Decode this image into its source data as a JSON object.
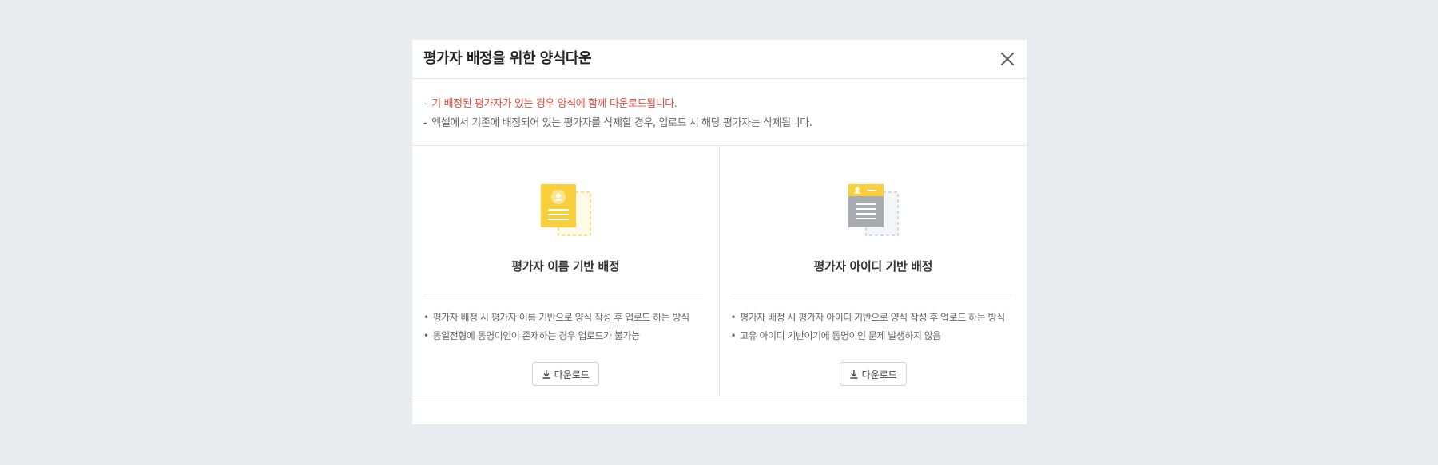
{
  "modal": {
    "title": "평가자 배정을 위한 양식다운",
    "close_icon": "close-icon"
  },
  "notice": {
    "lines": [
      {
        "dash": "-",
        "text": "기 배정된 평가자가 있는 경우 양식에 함께 다운로드됩니다.",
        "style": "warning",
        "color": "#e8493b"
      },
      {
        "dash": "-",
        "text": "엑셀에서 기존에 배정되어 있는 평가자를 삭제할 경우, 업로드 시 해당 평가자는 삭제됩니다.",
        "style": "normal"
      }
    ]
  },
  "options": [
    {
      "icon": "name-document-icon",
      "title": "평가자 이름 기반 배정",
      "bullets": [
        "평가자 배정 시 평가자 이름 기반으로 양식 작성 후 업로드 하는 방식",
        "동일전형에 동명이인이 존재하는 경우 업로드가 불가능"
      ],
      "download_label": "다운로드"
    },
    {
      "icon": "id-document-icon",
      "title": "평가자 아이디 기반 배정",
      "bullets": [
        "평가자 배정 시 평가자 아이디 기반으로 양식 작성 후 업로드 하는 방식",
        "고유 아이디 기반이기에 동명이인 문제 발생하지 않음"
      ],
      "download_label": "다운로드"
    }
  ],
  "colors": {
    "accent_yellow": "#f9cf3b",
    "warning_red": "#e8493b",
    "gray_doc": "#a8acb1",
    "background": "#e9ecef"
  }
}
